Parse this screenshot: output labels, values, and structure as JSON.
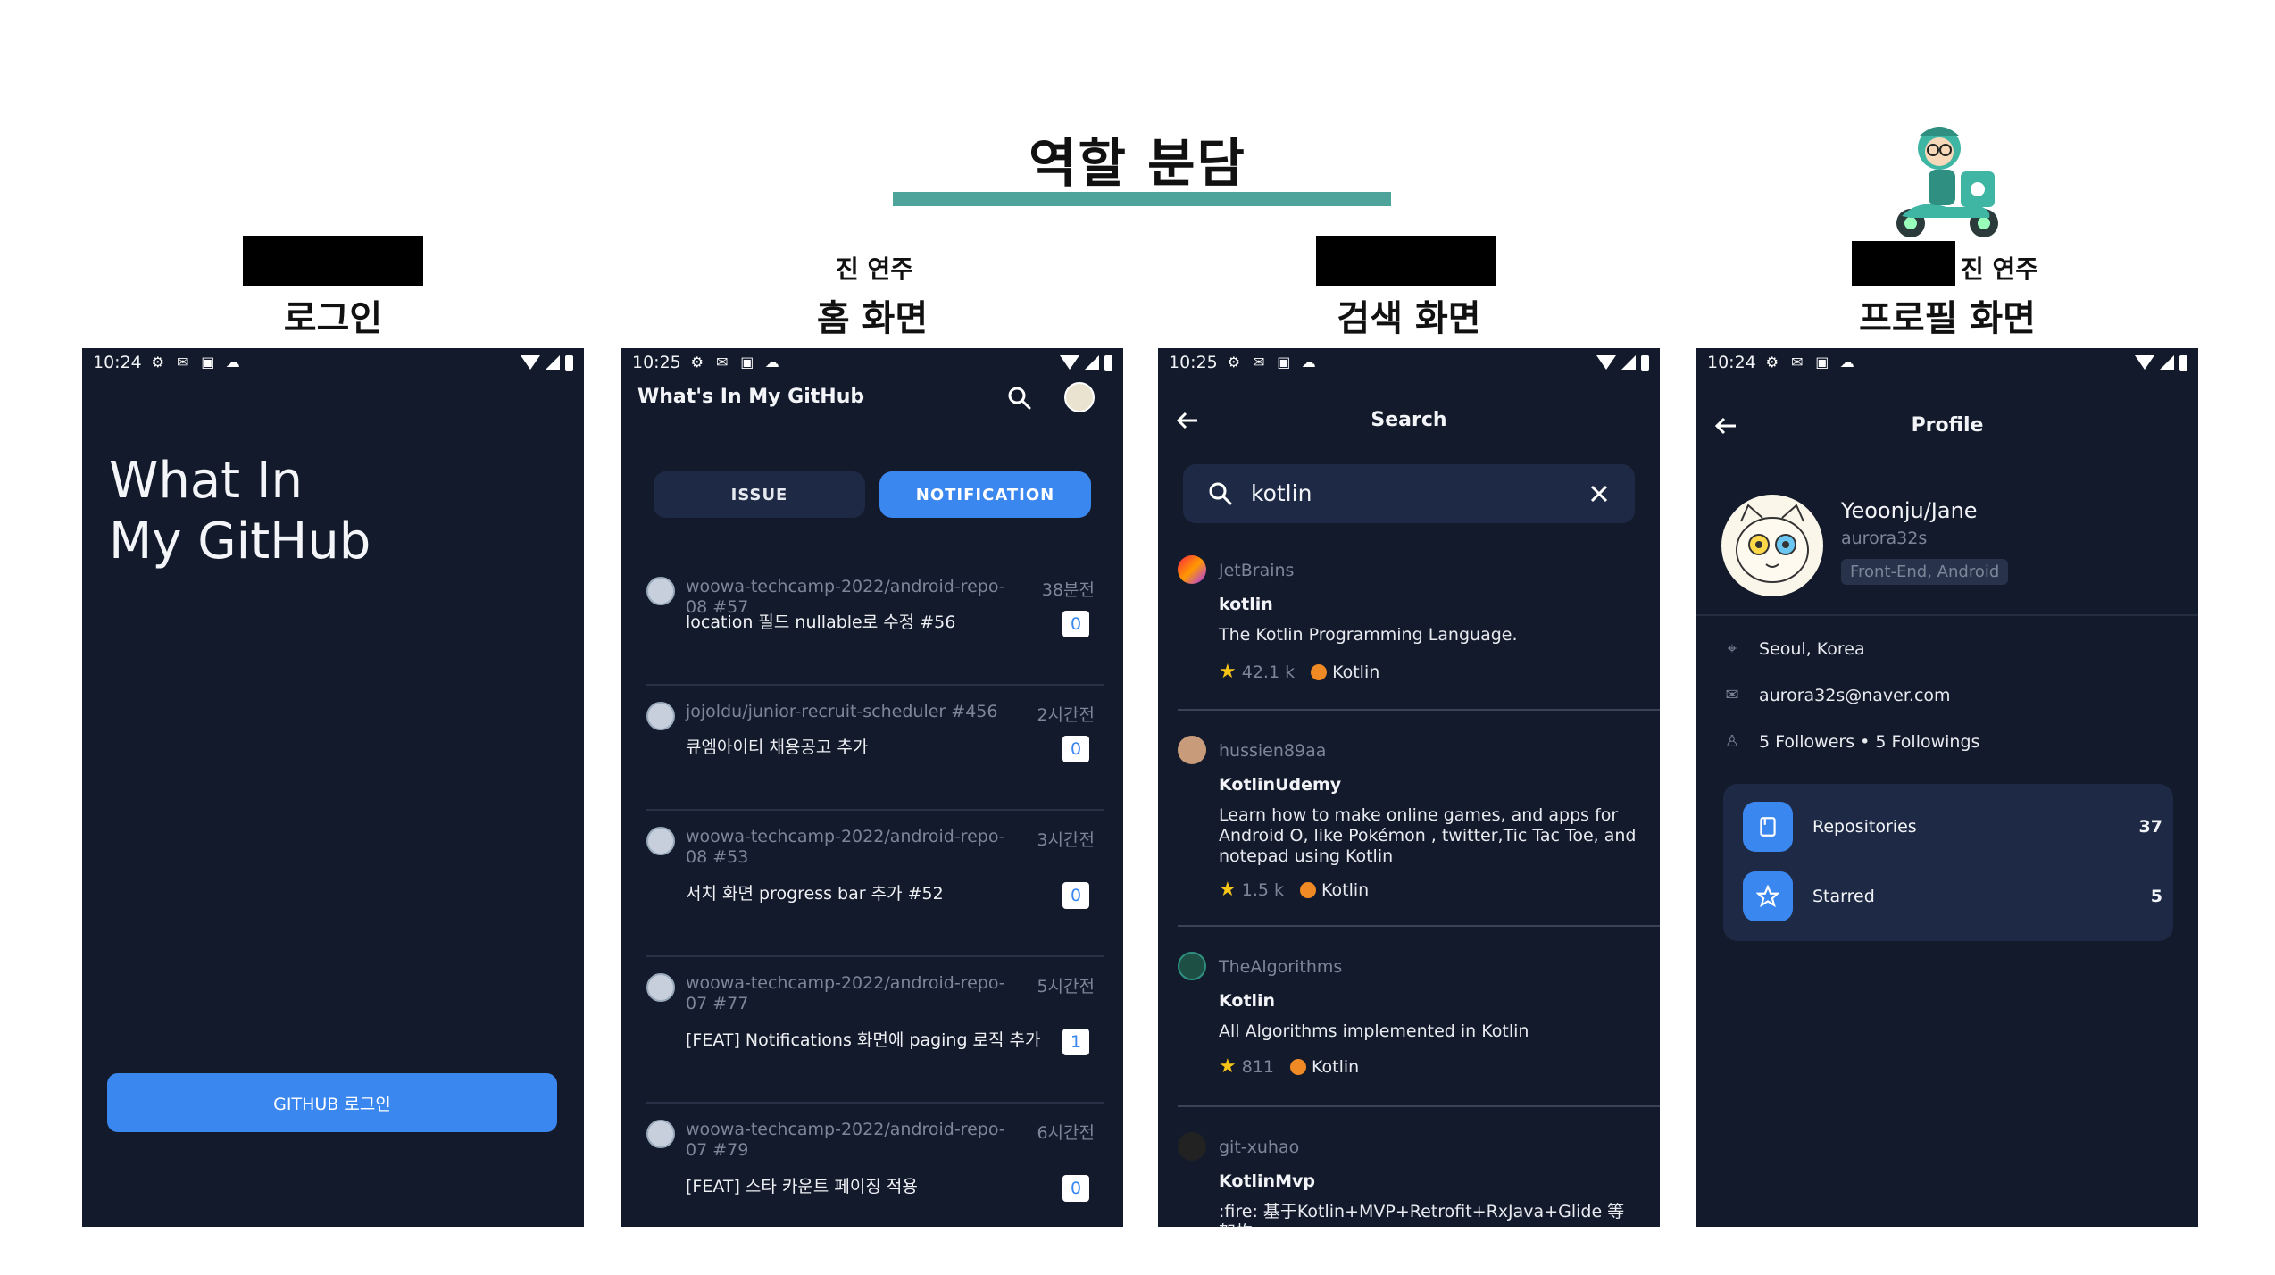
{
  "header": {
    "title": "역할 분담"
  },
  "columns": [
    {
      "person": "",
      "screen": "로그인"
    },
    {
      "person": "진 연주",
      "screen": "홈 화면"
    },
    {
      "person": "",
      "screen": "검색 화면"
    },
    {
      "person": "진 연주",
      "screen": "프로필 화면"
    }
  ],
  "status": {
    "login": "10:24",
    "home": "10:25",
    "search": "10:25",
    "profile": "10:24"
  },
  "login": {
    "title_line1": "What In",
    "title_line2": "My GitHub",
    "button": "GITHUB 로그인"
  },
  "home": {
    "app_title": "What's In My GitHub",
    "tabs": [
      {
        "label": "ISSUE"
      },
      {
        "label": "NOTIFICATION"
      }
    ],
    "notifications": [
      {
        "repo": "woowa-techcamp-2022/android-repo-08 #57",
        "time": "38분전",
        "text": "location 필드 nullable로 수정 #56",
        "count": "0"
      },
      {
        "repo": "jojoldu/junior-recruit-scheduler #456",
        "time": "2시간전",
        "text": "큐엠아이티 채용공고 추가",
        "count": "0"
      },
      {
        "repo": "woowa-techcamp-2022/android-repo-08 #53",
        "time": "3시간전",
        "text": "서치 화면 progress bar 추가 #52",
        "count": "0"
      },
      {
        "repo": "woowa-techcamp-2022/android-repo-07 #77",
        "time": "5시간전",
        "text": "[FEAT] Notifications 화면에 paging 로직 추가",
        "count": "1"
      },
      {
        "repo": "woowa-techcamp-2022/android-repo-07 #79",
        "time": "6시간전",
        "text": "[FEAT] 스타 카운트 페이징 적용",
        "count": "0"
      }
    ]
  },
  "search": {
    "title": "Search",
    "query": "kotlin",
    "results": [
      {
        "owner": "JetBrains",
        "name": "kotlin",
        "desc": "The Kotlin Programming Language.",
        "stars": "42.1 k",
        "language": "Kotlin"
      },
      {
        "owner": "hussien89aa",
        "name": "KotlinUdemy",
        "desc": "Learn how to make online games, and apps for Android O, like Pokémon , twitter,Tic Tac Toe, and notepad using Kotlin",
        "stars": "1.5 k",
        "language": "Kotlin"
      },
      {
        "owner": "TheAlgorithms",
        "name": "Kotlin",
        "desc": "All Algorithms implemented in Kotlin",
        "stars": "811",
        "language": "Kotlin"
      },
      {
        "owner": "git-xuhao",
        "name": "KotlinMvp",
        "desc": ":fire: 基于Kotlin+MVP+Retrofit+RxJava+Glide 等架构",
        "stars": "",
        "language": ""
      }
    ]
  },
  "profile": {
    "title": "Profile",
    "name": "Yeoonju/Jane",
    "login": "aurora32s",
    "tag": "Front-End, Android",
    "location": "Seoul, Korea",
    "email": "aurora32s@naver.com",
    "follow": "5 Followers • 5 Followings",
    "repositories_label": "Repositories",
    "repositories_count": "37",
    "starred_label": "Starred",
    "starred_count": "5"
  },
  "colors": {
    "accent": "#3b87f0",
    "phone_bg": "#131a2b",
    "teal_bar": "#4ea39b",
    "star": "#f5c518",
    "kotlin": "#f08a24"
  }
}
